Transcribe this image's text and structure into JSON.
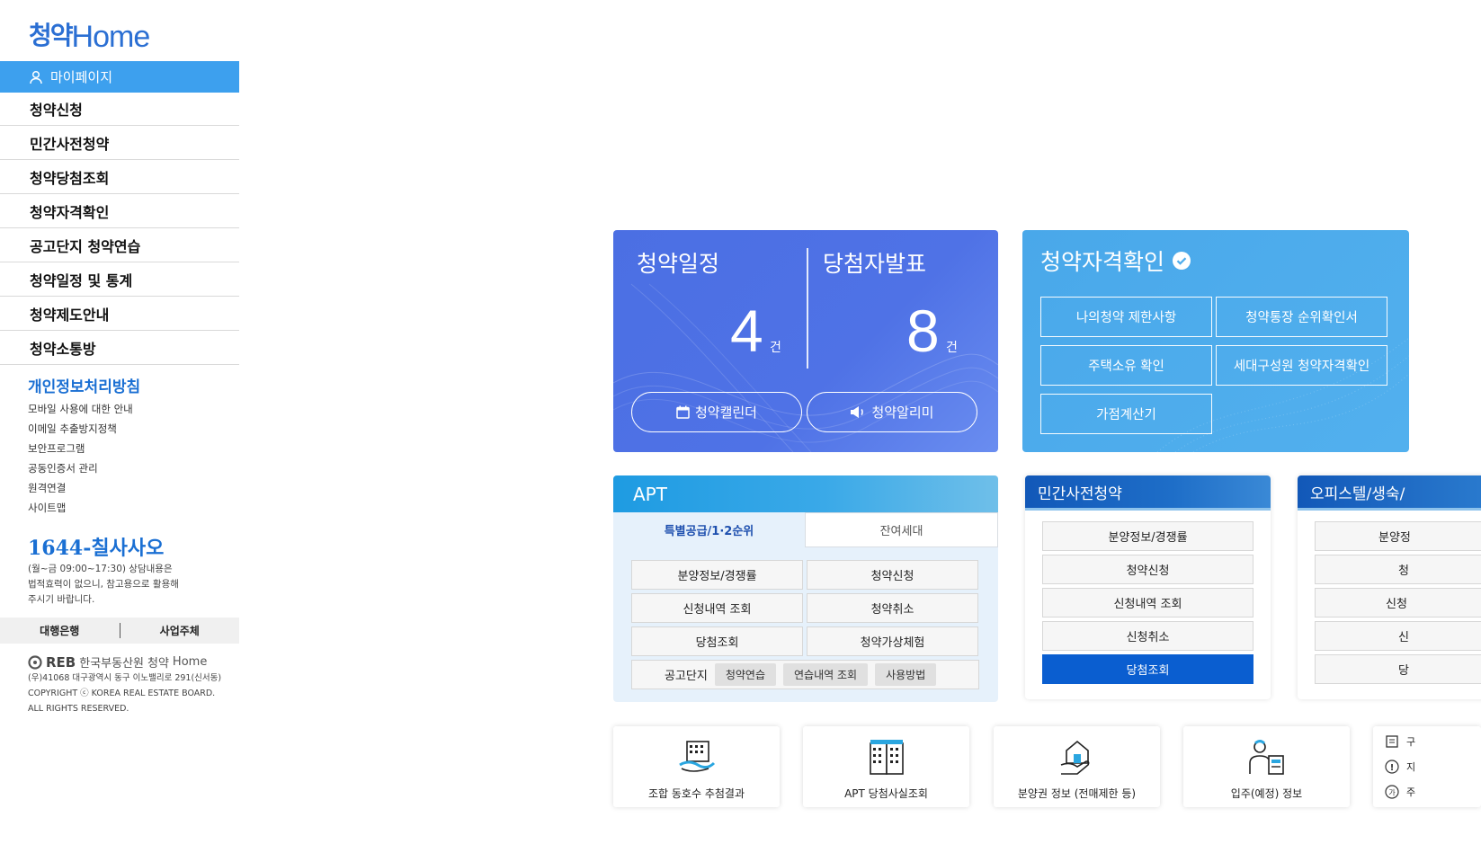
{
  "logo": {
    "ko": "청약",
    "en": "Home"
  },
  "mypage": {
    "label": "마이페이지"
  },
  "nav": [
    "청약신청",
    "민간사전청약",
    "청약당첨조회",
    "청약자격확인",
    "공고단지 청약연습",
    "청약일정 및 통계",
    "청약제도안내",
    "청약소통방"
  ],
  "privacy": {
    "title": "개인정보처리방침",
    "links": [
      "모바일 사용에 대한 안내",
      "이메일 추출방지정책",
      "보안프로그램",
      "공동인증서 관리",
      "원격연결",
      "사이트맵"
    ]
  },
  "contact": {
    "phone": "1644-칠사사오",
    "hours": [
      "(월~금 09:00~17:30) 상담내용은",
      "법적효력이 없으니, 참고용으로 활용해",
      "주시기 바랍니다."
    ]
  },
  "bankbar": {
    "left": "대행은행",
    "right": "사업주체"
  },
  "footer": {
    "reb": "REB",
    "org": "한국부동산원",
    "brand_ko": "청약",
    "brand_en": "Home",
    "address": "(우)41068 대구광역시 동구 이노밸리로 291(신서동)",
    "copyright1": "COPYRIGHT ⓒ KOREA REAL ESTATE BOARD.",
    "copyright2": "ALL RIGHTS RESERVED."
  },
  "schedule_card": {
    "left_title": "청약일정",
    "left_count": "4",
    "right_title": "당첨자발표",
    "right_count": "8",
    "unit": "건",
    "calendar_btn": "청약캘린더",
    "alarm_btn": "청약알리미",
    "bg_color": "#4f72e6"
  },
  "qualify_card": {
    "title": "청약자격확인",
    "buttons": [
      "나의청약 제한사항",
      "청약통장 순위확인서",
      "주택소유 확인",
      "세대구성원 청약자격확인",
      "가점계산기"
    ],
    "bg_color": "#4fadec"
  },
  "apt_card": {
    "title": "APT",
    "tab_active": "특별공급/1·2순위",
    "tab_inactive": "잔여세대",
    "buttons": [
      "분양정보/경쟁률",
      "청약신청",
      "신청내역 조회",
      "청약취소",
      "당첨조회",
      "청약가상체험"
    ],
    "row4_label": "공고단지",
    "chips": [
      "청약연습",
      "연습내역 조회",
      "사용방법"
    ]
  },
  "pre_card": {
    "title": "민간사전청약",
    "buttons": [
      "분양정보/경쟁률",
      "청약신청",
      "신청내역 조회",
      "신청취소",
      "당첨조회"
    ],
    "accent": "#0a5ed0"
  },
  "officetel_card": {
    "title": "오피스텔/생숙/",
    "buttons": [
      "분양정",
      "청",
      "신청",
      "신",
      "당"
    ]
  },
  "quick_links": [
    "조합 동호수 추첨결과",
    "APT 당첨사실조회",
    "분양권 정보 (전매제한 등)",
    "입주(예정) 정보"
  ],
  "quick_edge": [
    "구",
    "지",
    "주"
  ]
}
